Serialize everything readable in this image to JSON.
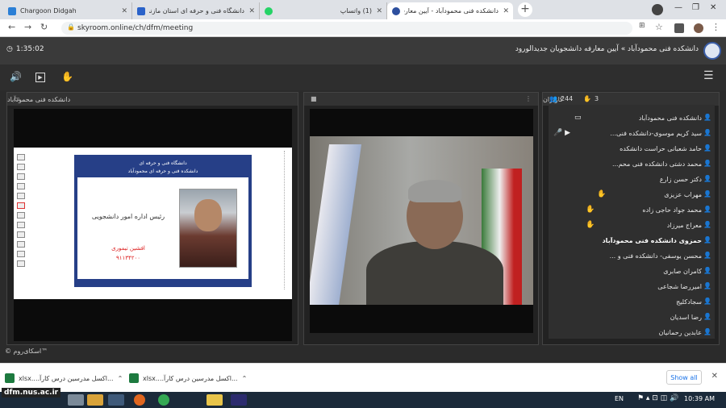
{
  "browser": {
    "tabs": [
      {
        "title": "Chargoon Didgah",
        "color": "#2b7fd6"
      },
      {
        "title": "دانشگاه فنی و حرفه ای استان مازندران",
        "color": "#2a62c9"
      },
      {
        "title": "(1) واتساپ",
        "color": "#25d366"
      },
      {
        "title": "دانشکده فنی محمودآباد - آیین معارفه",
        "color": "#2d4f9e"
      }
    ],
    "new_tab": "+",
    "url": "skyroom.online/ch/dfm/meeting"
  },
  "app": {
    "timer": "1:35:02",
    "room_title": "دانشکده فنی محمودآباد » آیین معارفه دانشجویان جدیدالورود"
  },
  "panels": {
    "presentation_title": "دانشکده فنی محمودآباد",
    "users_title": "کاربران",
    "users_count": "244",
    "hands_count": "3"
  },
  "slide": {
    "header_line1": "دانشگاه فنی و حرفه ای",
    "header_line2": "دانشکده فنی و حرفه ای محمودآباد",
    "role": "رئیس اداره امور دانشجویی",
    "name": "افشین تیموری",
    "phone": "۹۱۱۳۴۲۰۰"
  },
  "users": [
    {
      "name": "دانشکده فنی محمودآباد",
      "color": "b",
      "ext": ""
    },
    {
      "name": "سید کریم موسوی-دانشکده فنی...",
      "color": "b",
      "ext": "🎤 ▶"
    },
    {
      "name": "حامد شعبانی حراست دانشکده",
      "color": "b",
      "ext": ""
    },
    {
      "name": "محمد دشتی دانشکده فنی محم...",
      "color": "b",
      "ext": ""
    },
    {
      "name": "دکتر حسن زارع",
      "color": "b",
      "ext": ""
    },
    {
      "name": "مهراب عزیزی",
      "color": "y",
      "ext": "✋"
    },
    {
      "name": "محمد جواد حاجی زاده",
      "color": "y",
      "ext": "✋"
    },
    {
      "name": "معراج میرزاد",
      "color": "y",
      "ext": "✋"
    },
    {
      "name": "حمزوی دانشکده فنی محمودآباد",
      "color": "y",
      "ext": "",
      "bold": true
    },
    {
      "name": "محسن یوسفی- دانشکده فنی و ...",
      "color": "y",
      "ext": ""
    },
    {
      "name": "کامران صابری",
      "color": "y",
      "ext": ""
    },
    {
      "name": "امیررضا شجاعی",
      "color": "y",
      "ext": ""
    },
    {
      "name": "سجادکلیج",
      "color": "y",
      "ext": ""
    },
    {
      "name": "رضا اسدیان",
      "color": "y",
      "ext": ""
    },
    {
      "name": "عابدین رحمانیان",
      "color": "y",
      "ext": ""
    }
  ],
  "footer": {
    "copyright": "© اسکای‌روم™"
  },
  "downloads": [
    {
      "label": "...اکسل مدرسین درس کارآ....xlsx"
    },
    {
      "label": "...اکسل مدرسین درس کارآ....xlsx"
    }
  ],
  "show_all": "Show all",
  "taskbar": {
    "lang": "EN",
    "time": "10:39 AM",
    "watermark": "dfm.nus.ac.ir"
  }
}
